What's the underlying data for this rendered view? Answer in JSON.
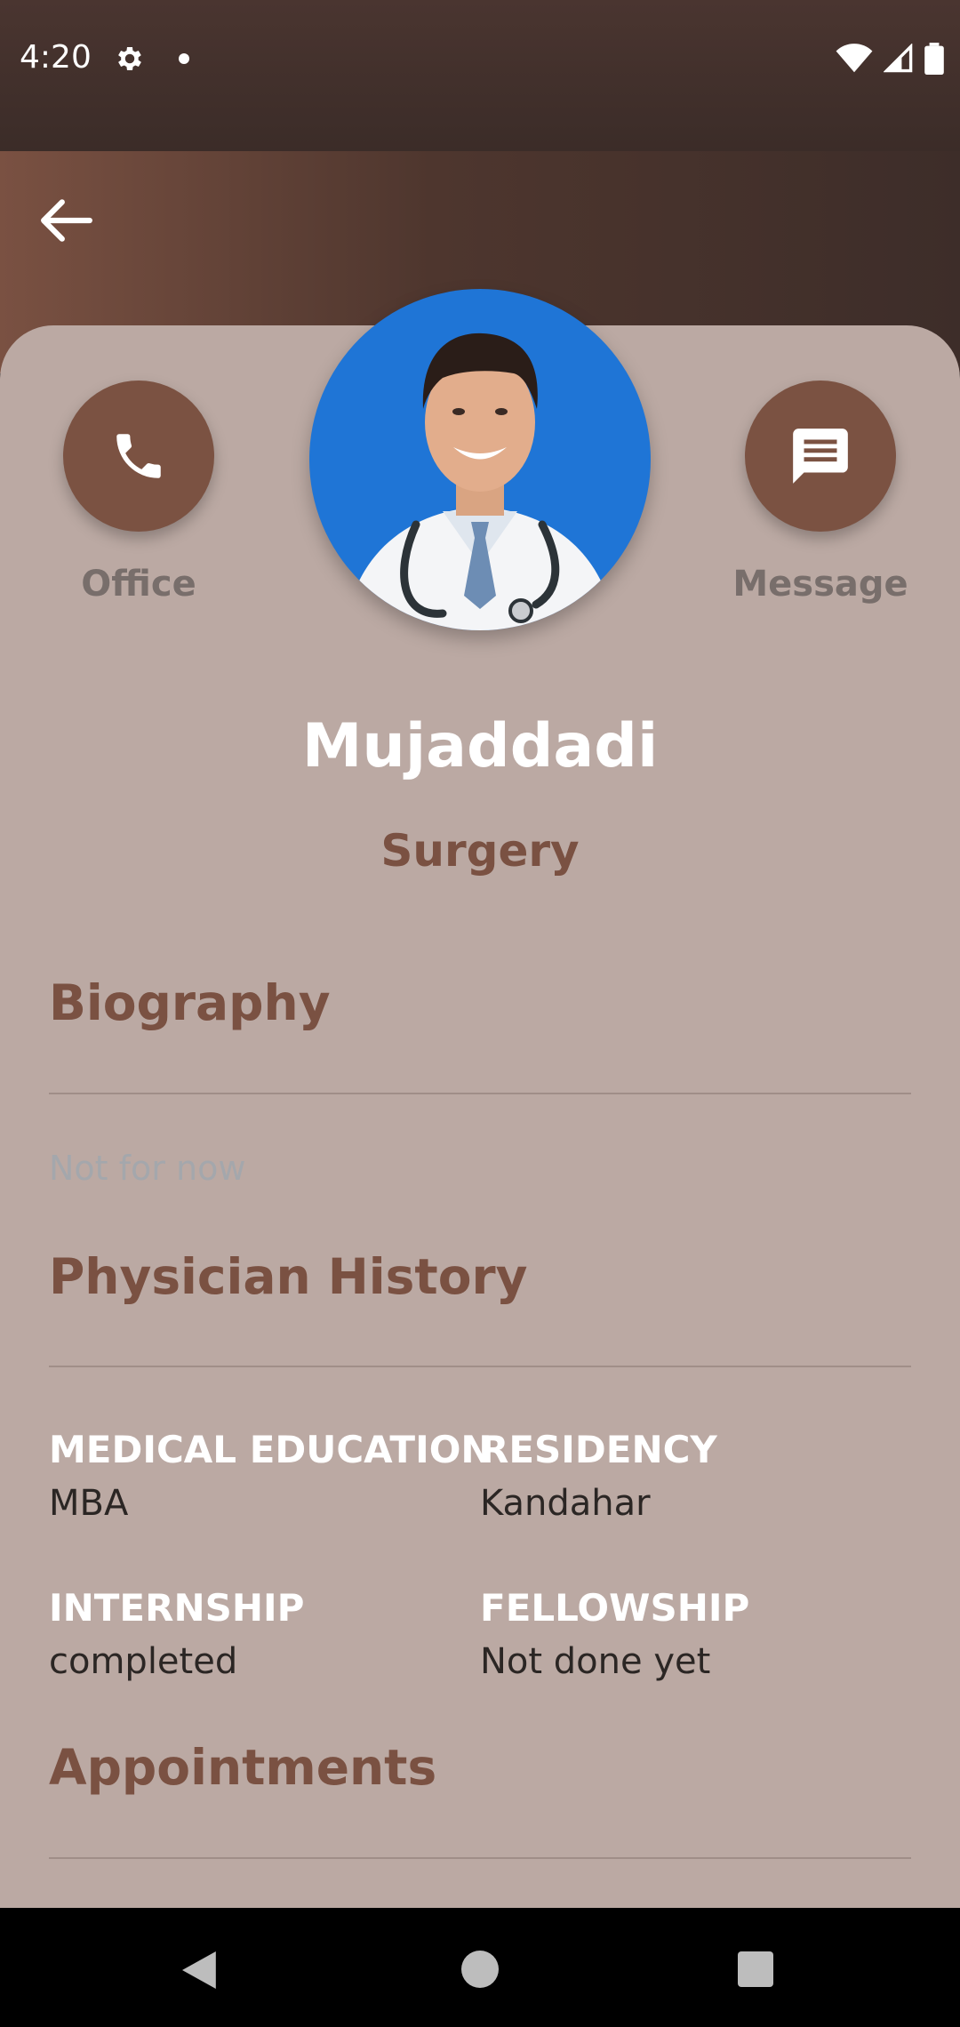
{
  "status": {
    "time": "4:20"
  },
  "doctor": {
    "name": "Mujaddadi",
    "specialty": "Surgery"
  },
  "actions": {
    "office_label": "Office",
    "message_label": "Message"
  },
  "biography": {
    "title": "Biography",
    "text": "Not for now"
  },
  "history": {
    "title": "Physician History",
    "fields": [
      {
        "label": "MEDICAL EDUCATION",
        "value": "MBA"
      },
      {
        "label": "RESIDENCY",
        "value": "Kandahar"
      },
      {
        "label": "INTERNSHIP",
        "value": "completed"
      },
      {
        "label": "FELLOWSHIP",
        "value": "Not done yet"
      }
    ]
  },
  "appointments": {
    "title": "Appointments"
  },
  "colors": {
    "accent": "#7a5142",
    "card": "#bba9a3",
    "avatar_bg": "#1f75d6"
  }
}
